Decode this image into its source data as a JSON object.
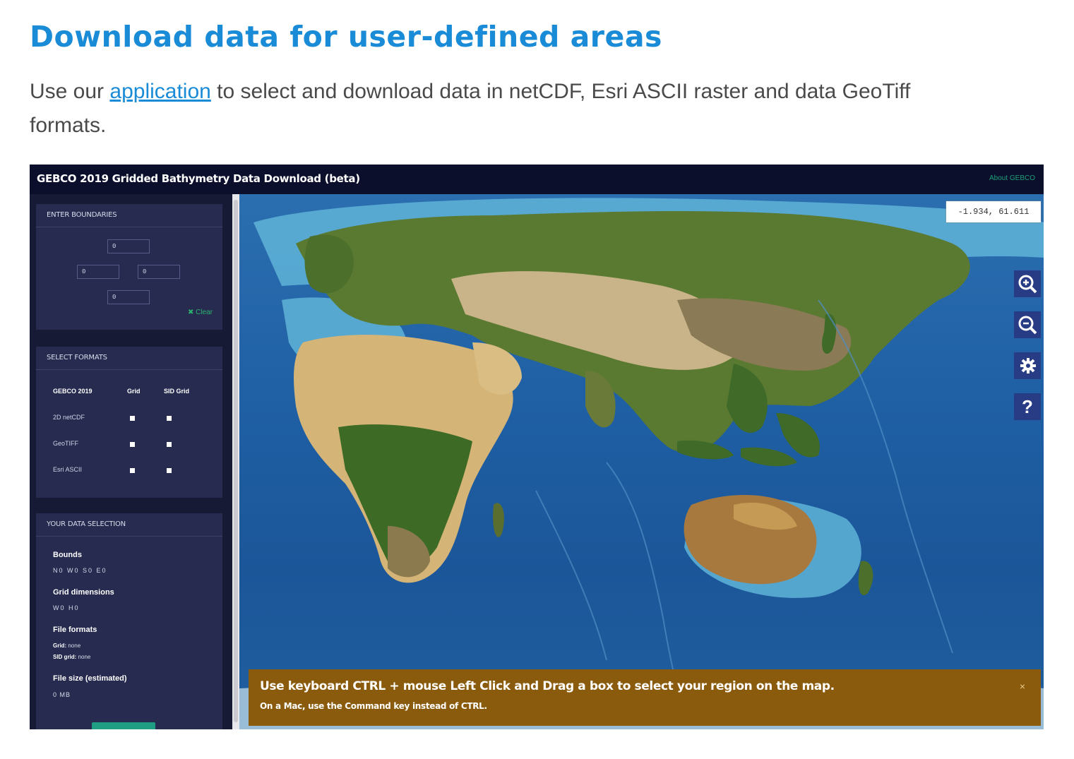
{
  "page": {
    "title": "Download data for user-defined areas",
    "intro_before": "Use our ",
    "intro_link": "application",
    "intro_after": " to select and download data in netCDF, Esri ASCII raster and data GeoTiff formats."
  },
  "app": {
    "title": "GEBCO 2019 Gridded Bathymetry Data Download (beta)",
    "about": "About GEBCO",
    "boundaries": {
      "heading": "ENTER BOUNDARIES",
      "north": "0",
      "west": "0",
      "east": "0",
      "south": "0",
      "clear": "✖ Clear"
    },
    "formats": {
      "heading": "SELECT FORMATS",
      "col_product": "GEBCO 2019",
      "col_grid": "Grid",
      "col_sid": "SID Grid",
      "rows": [
        "2D netCDF",
        "GeoTIFF",
        "Esri ASCII"
      ]
    },
    "selection": {
      "heading": "YOUR DATA SELECTION",
      "bounds_label": "Bounds",
      "bounds_value": "N0 W0 S0 E0",
      "grid_label": "Grid dimensions",
      "grid_value": "W0 H0",
      "formats_label": "File formats",
      "grid_format_label": "Grid:",
      "grid_format_value": "none",
      "sid_format_label": "SID grid:",
      "sid_format_value": "none",
      "size_label": "File size (estimated)",
      "size_value": "0 MB"
    },
    "map": {
      "coords": "-1.934,  61.611",
      "controls": [
        "zoom-in-icon",
        "zoom-out-icon",
        "gear-icon",
        "help-icon"
      ]
    },
    "hint": {
      "main": "Use keyboard CTRL + mouse Left Click and Drag a box to select your region on the map.",
      "sub": "On a Mac, use the Command key instead of CTRL.",
      "close": "×"
    }
  },
  "colors": {
    "title_blue": "#1a8bd6",
    "header_bg": "#0b0f2c",
    "sidebar_bg": "#161a35",
    "panel_bg": "#262b4f",
    "hint_bg": "#8a5b0c",
    "ocean": "#1f5fa4"
  }
}
